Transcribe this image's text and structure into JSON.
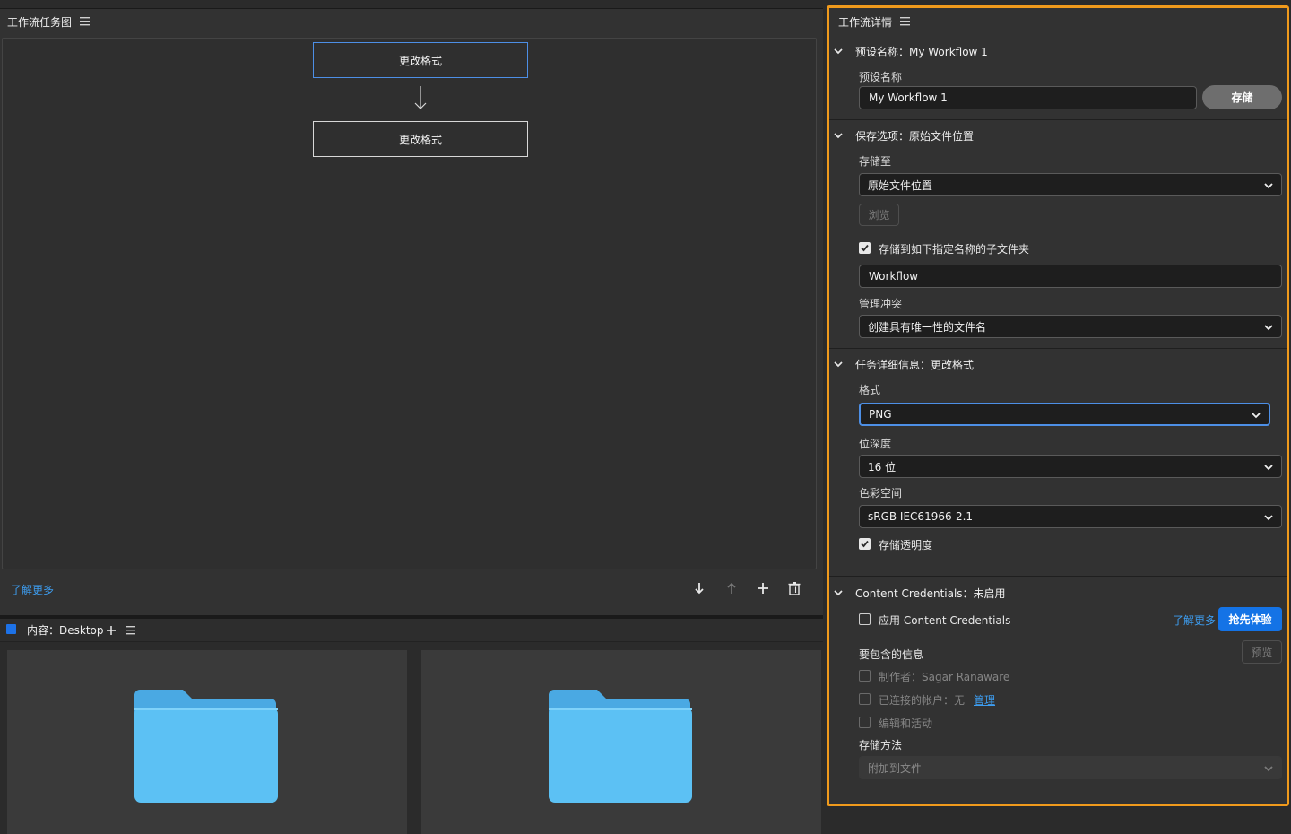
{
  "workflow_graph": {
    "title": "工作流任务图",
    "nodes": [
      "更改格式",
      "更改格式"
    ],
    "learn_more": "了解更多"
  },
  "content": {
    "label": "内容：Desktop"
  },
  "details": {
    "title": "工作流详情",
    "preset": {
      "section_title": "预设名称：My Workflow 1",
      "label": "预设名称",
      "value": "My Workflow 1",
      "save_button": "存储"
    },
    "save_options": {
      "section_title": "保存选项：原始文件位置",
      "save_to_label": "存储至",
      "save_to_value": "原始文件位置",
      "browse_button": "浏览",
      "subfolder_checkbox": "存储到如下指定名称的子文件夹",
      "subfolder_checked": true,
      "subfolder_value": "Workflow",
      "conflict_label": "管理冲突",
      "conflict_value": "创建具有唯一性的文件名"
    },
    "task_details": {
      "section_title": "任务详细信息：更改格式",
      "format_label": "格式",
      "format_value": "PNG",
      "bit_depth_label": "位深度",
      "bit_depth_value": "16 位",
      "color_space_label": "色彩空间",
      "color_space_value": "sRGB IEC61966-2.1",
      "transparency_checkbox": "存储透明度",
      "transparency_checked": true
    },
    "content_credentials": {
      "section_title": "Content Credentials：未启用",
      "apply_checkbox": "应用 Content Credentials",
      "learn_more": "了解更多",
      "try_button": "抢先体验",
      "include_label": "要包含的信息",
      "preview_button": "预览",
      "producer": "制作者：Sagar Ranaware",
      "connected_accounts": "已连接的帐户：无",
      "manage_link": "管理",
      "edits": "编辑和活动",
      "storage_label": "存储方法",
      "storage_value": "附加到文件"
    }
  },
  "colors": {
    "accent_orange": "#f09a1c",
    "link_blue": "#3d9df0",
    "button_blue": "#1473e6",
    "folder_blue": "#5cc1f4"
  }
}
